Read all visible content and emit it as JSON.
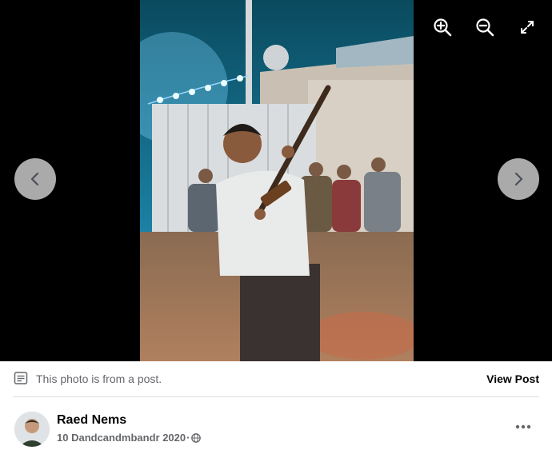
{
  "viewer": {
    "photo_alt": "",
    "zoom_in_icon": "zoom-in-icon",
    "zoom_out_icon": "zoom-out-icon",
    "fullscreen_icon": "fullscreen-icon",
    "prev_icon": "chevron-left-icon",
    "next_icon": "chevron-right-icon"
  },
  "post_bar": {
    "note": "This photo is from a post.",
    "view_post": "View Post"
  },
  "author": {
    "name": "Raed Nems",
    "date": "10 Dandcandmbandr 2020",
    "separator": "·",
    "privacy_icon": "globe-icon",
    "more_icon": "more-options-icon"
  }
}
